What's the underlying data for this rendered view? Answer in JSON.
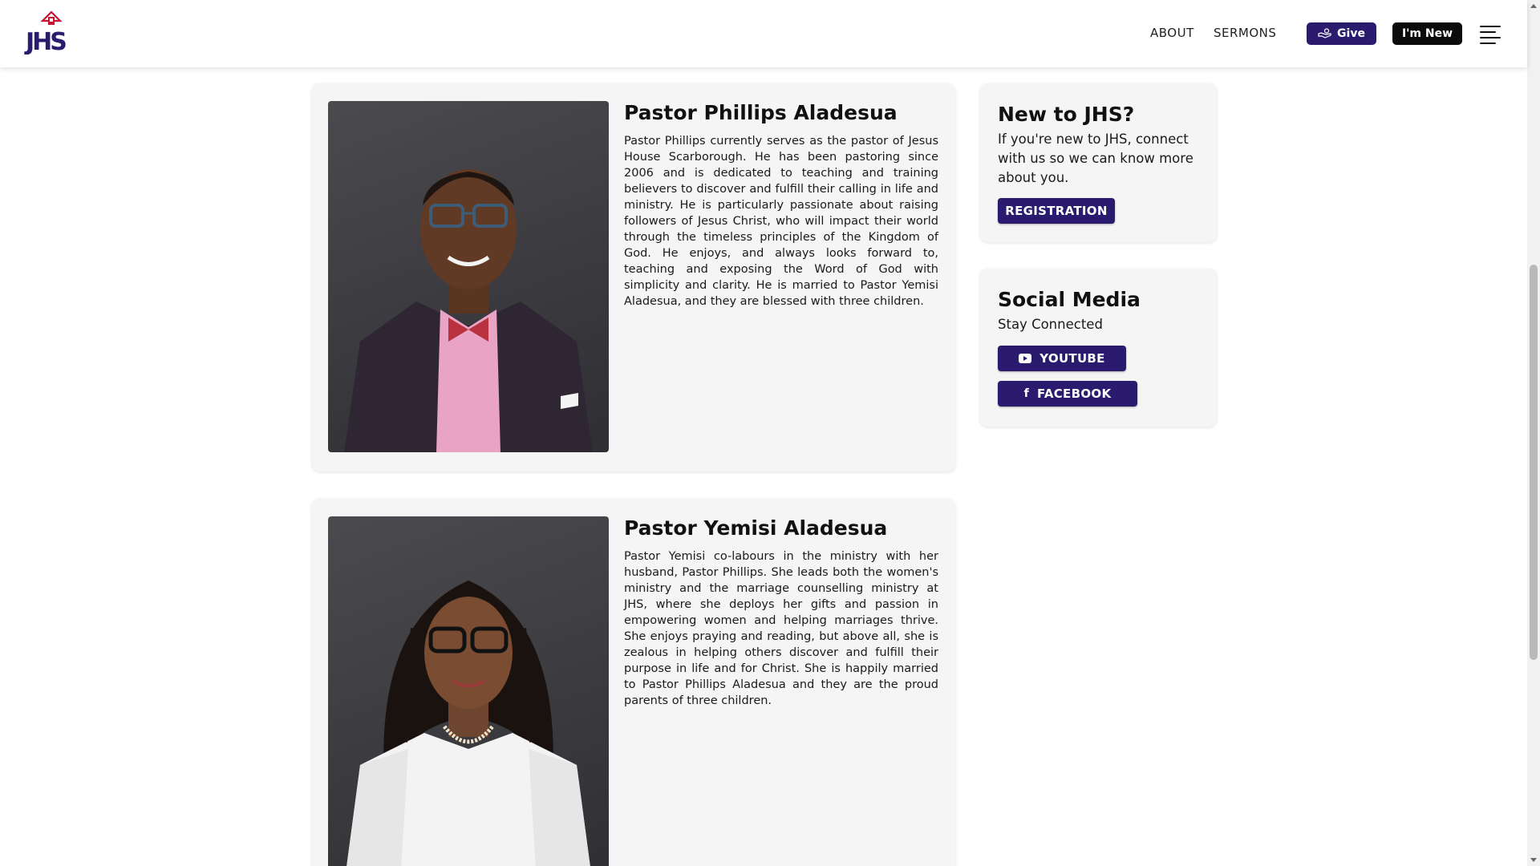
{
  "header": {
    "logo_text": "JHS",
    "nav": [
      {
        "label": "ABOUT"
      },
      {
        "label": "SERMONS"
      }
    ],
    "give_label": "Give",
    "new_label": "I'm New",
    "menu_icon": "hamburger-menu-icon"
  },
  "pastors": [
    {
      "name": "Pastor Phillips Aladesua",
      "bio": "Pastor Phillips currently serves as the pastor of Jesus House Scarborough. He has been pastoring since 2006 and is dedicated to teaching and training believers to discover and fulfill their calling in life and ministry. He is particularly passionate about raising followers of Jesus Christ, who will impact their world through the timeless principles of the Kingdom of God. He enjoys, and always looks forward to, teaching and exposing the Word of God with simplicity and clarity. He is married to Pastor Yemisi Aladesua, and they are blessed with three children."
    },
    {
      "name": "Pastor Yemisi Aladesua",
      "bio": "Pastor Yemisi co-labours in the ministry with her husband, Pastor Phillips. She leads both the women's ministry and the marriage counselling ministry at JHS, where she deploys her gifts and passion in empowering women and helping marriages thrive. She enjoys praying and reading, but above all, she is zealous in helping others discover and fulfill their purpose in life and for Christ. She is happily married to Pastor Phillips Aladesua and they are the proud parents of three children."
    }
  ],
  "sidebar": {
    "new": {
      "title": "New to JHS?",
      "text": "If you're new to JHS, connect with us so we can know more about you.",
      "button": "REGISTRATION"
    },
    "social": {
      "title": "Social Media",
      "text": "Stay Connected",
      "youtube": "YOUTUBE",
      "facebook": "FACEBOOK"
    }
  },
  "colors": {
    "brand": "#2b1b6e",
    "dark_button": "#0b0b0b",
    "card_bg": "#f5f5f5",
    "logo_red": "#c8102e"
  }
}
